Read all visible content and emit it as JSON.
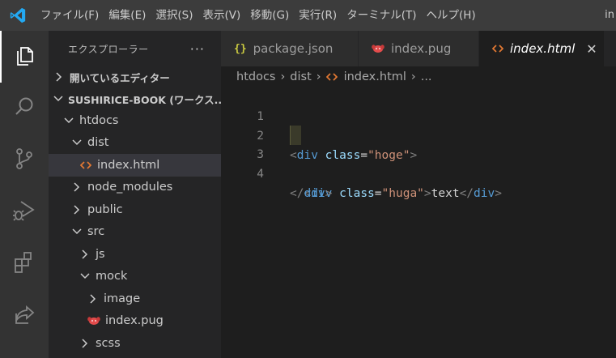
{
  "titlebar": {
    "menu": [
      "ファイル(F)",
      "編集(E)",
      "選択(S)",
      "表示(V)",
      "移動(G)",
      "実行(R)",
      "ターミナル(T)",
      "ヘルプ(H)"
    ],
    "title_truncated": "in"
  },
  "activitybar": {
    "items": [
      {
        "icon": "explorer-icon",
        "active": true
      },
      {
        "icon": "search-icon",
        "active": false
      },
      {
        "icon": "source-control-icon",
        "active": false
      },
      {
        "icon": "run-debug-icon",
        "active": false
      },
      {
        "icon": "extensions-icon",
        "active": false
      },
      {
        "icon": "live-share-icon",
        "active": false
      }
    ]
  },
  "sidebar": {
    "title": "エクスプローラー",
    "more": "···",
    "open_editors": "開いているエディター",
    "workspace": "SUSHIRICE-BOOK (ワークス...",
    "tree": [
      {
        "label": "htdocs",
        "depth": 1,
        "type": "folder",
        "expanded": true
      },
      {
        "label": "dist",
        "depth": 2,
        "type": "folder",
        "expanded": true
      },
      {
        "label": "index.html",
        "depth": 3,
        "type": "html",
        "selected": true
      },
      {
        "label": "node_modules",
        "depth": 2,
        "type": "folder",
        "expanded": false
      },
      {
        "label": "public",
        "depth": 2,
        "type": "folder",
        "expanded": false
      },
      {
        "label": "src",
        "depth": 2,
        "type": "folder",
        "expanded": true
      },
      {
        "label": "js",
        "depth": 3,
        "type": "folder",
        "expanded": false
      },
      {
        "label": "mock",
        "depth": 3,
        "type": "folder",
        "expanded": true
      },
      {
        "label": "image",
        "depth": 4,
        "type": "folder",
        "expanded": false
      },
      {
        "label": "index.pug",
        "depth": 4,
        "type": "pug"
      },
      {
        "label": "scss",
        "depth": 3,
        "type": "folder",
        "expanded": false
      }
    ]
  },
  "tabs": [
    {
      "label": "package.json",
      "icon": "json-icon",
      "active": false
    },
    {
      "label": "index.pug",
      "icon": "pug-icon",
      "active": false
    },
    {
      "label": "index.html",
      "icon": "html-icon",
      "active": true,
      "close": "✕"
    }
  ],
  "breadcrumb": {
    "parts": [
      "htdocs",
      "dist",
      "index.html",
      "..."
    ],
    "sep": "›"
  },
  "editor": {
    "line_numbers": [
      "1",
      "2",
      "3",
      "4"
    ],
    "lines": [
      [],
      [
        {
          "t": "<",
          "c": "punc"
        },
        {
          "t": "div",
          "c": "tag"
        },
        {
          "t": " ",
          "c": "text"
        },
        {
          "t": "class",
          "c": "attr"
        },
        {
          "t": "=",
          "c": "text"
        },
        {
          "t": "\"hoge\"",
          "c": "str"
        },
        {
          "t": ">",
          "c": "punc"
        }
      ],
      [
        {
          "t": "  ",
          "c": "text"
        },
        {
          "t": "<",
          "c": "punc"
        },
        {
          "t": "div",
          "c": "tag"
        },
        {
          "t": " ",
          "c": "text"
        },
        {
          "t": "class",
          "c": "attr"
        },
        {
          "t": "=",
          "c": "text"
        },
        {
          "t": "\"huga\"",
          "c": "str"
        },
        {
          "t": ">",
          "c": "punc"
        },
        {
          "t": "text",
          "c": "text"
        },
        {
          "t": "</",
          "c": "punc"
        },
        {
          "t": "div",
          "c": "tag"
        },
        {
          "t": ">",
          "c": "punc"
        }
      ],
      [
        {
          "t": "</",
          "c": "punc"
        },
        {
          "t": "div",
          "c": "tag"
        },
        {
          "t": ">",
          "c": "punc"
        }
      ]
    ]
  },
  "colors": {
    "accent_blue": "#23a9f2",
    "html_icon": "#e37933",
    "pug_icon": "#e34c4c",
    "json_icon": "#cbcb41"
  }
}
